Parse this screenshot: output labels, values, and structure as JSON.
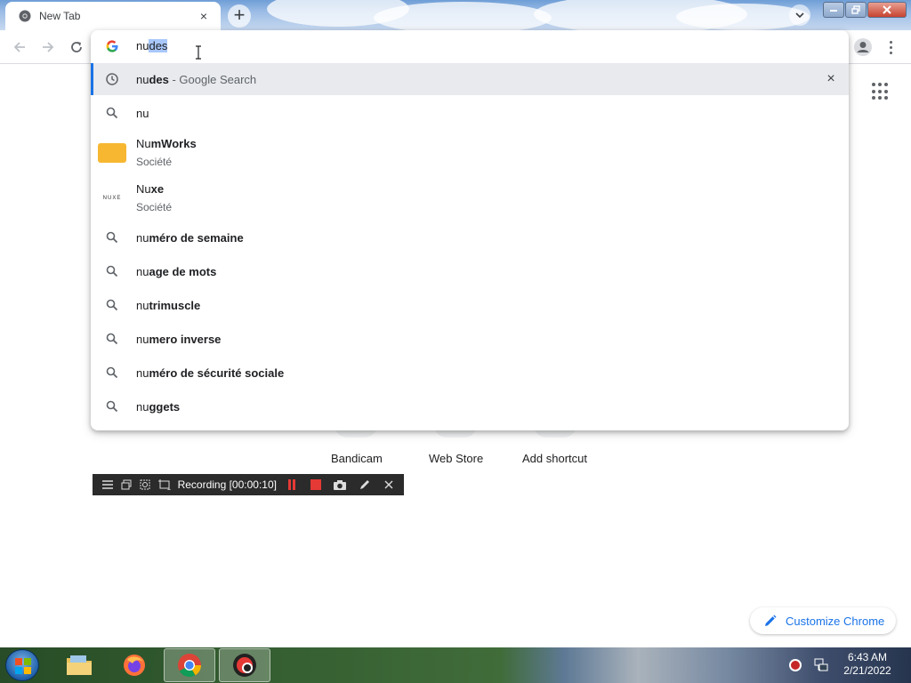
{
  "browser": {
    "tab_title": "New Tab",
    "tab_close": "×",
    "new_tab": "+"
  },
  "omnibox": {
    "typed": "nu",
    "autocomplete_selected": "des",
    "suggestions": [
      {
        "type": "history",
        "bold": "des",
        "plain": "nu",
        "desc": " - Google Search",
        "remove": "×"
      },
      {
        "type": "search",
        "plain": "nu",
        "bold": ""
      },
      {
        "type": "entity",
        "plain": "Nu",
        "bold": "mWorks",
        "sub": "Société"
      },
      {
        "type": "entity",
        "plain": "Nu",
        "bold": "xe",
        "sub": "Société",
        "logo": "NUXE"
      },
      {
        "type": "search",
        "plain": "nu",
        "bold": "méro de semaine"
      },
      {
        "type": "search",
        "plain": "nu",
        "bold": "age de mots"
      },
      {
        "type": "search",
        "plain": "nu",
        "bold": "trimuscle"
      },
      {
        "type": "search",
        "plain": "nu",
        "bold": "mero inverse"
      },
      {
        "type": "search",
        "plain": "nu",
        "bold": "méro de sécurité sociale"
      },
      {
        "type": "search",
        "plain": "nu",
        "bold": "ggets"
      }
    ]
  },
  "ntp": {
    "shortcuts": [
      "Bandicam",
      "Web Store",
      "Add shortcut"
    ],
    "customize_label": "Customize Chrome"
  },
  "bandicam": {
    "recording_label": "Recording [00:00:10]"
  },
  "taskbar": {
    "time": "6:43 AM",
    "date": "2/21/2022"
  },
  "colors": {
    "accent": "#1a73e8",
    "numworks_yellow": "#f7b731",
    "bandicam_red": "#e53935"
  }
}
